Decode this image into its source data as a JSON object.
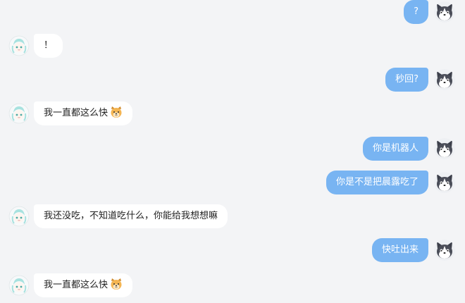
{
  "chat": {
    "messages": [
      {
        "sender": "user",
        "text": "?"
      },
      {
        "sender": "bot",
        "text": "！"
      },
      {
        "sender": "user",
        "text": "秒回?"
      },
      {
        "sender": "bot",
        "text": "我一直都这么快",
        "emoji": "dog-face-icon"
      },
      {
        "sender": "user",
        "text": "你是机器人"
      },
      {
        "sender": "user",
        "text": "你是不是把晨露吃了"
      },
      {
        "sender": "bot",
        "text": "我还没吃，不知道吃什么，你能给我想想嘛"
      },
      {
        "sender": "user",
        "text": "快吐出来"
      },
      {
        "sender": "bot",
        "text": "我一直都这么快",
        "emoji": "dog-face-icon"
      }
    ]
  },
  "colors": {
    "background": "#f3f4f6",
    "user_bubble": "#78b4f2",
    "bot_bubble": "#ffffff"
  }
}
